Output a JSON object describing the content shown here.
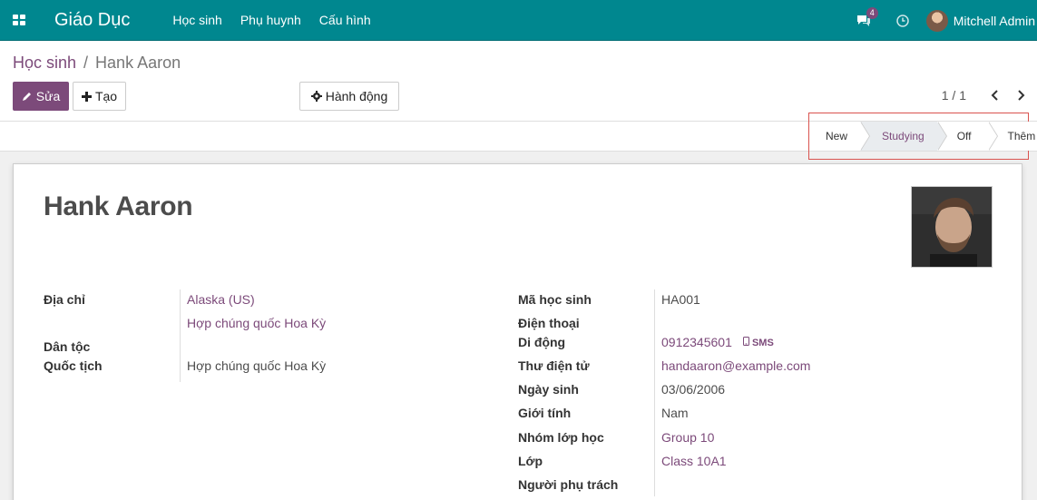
{
  "navbar": {
    "brand": "Giáo Dục",
    "menu": [
      "Học sinh",
      "Phụ huynh",
      "Cấu hình"
    ],
    "chat_count": "4",
    "user_name": "Mitchell Admin"
  },
  "breadcrumb": {
    "parent": "Học sinh",
    "separator": "/",
    "current": "Hank Aaron"
  },
  "toolbar": {
    "edit_label": "Sửa",
    "create_label": "Tạo",
    "action_label": "Hành động",
    "pager": "1 / 1"
  },
  "statusbar": {
    "stages": [
      "New",
      "Studying",
      "Off"
    ],
    "active_stage": "Studying",
    "more_label": "Thêm"
  },
  "record": {
    "name": "Hank Aaron",
    "left_fields": {
      "address_label": "Địa chỉ",
      "address_state": "Alaska (US)",
      "address_country": "Hợp chúng quốc Hoa Kỳ",
      "ethnicity_label": "Dân tộc",
      "ethnicity_value": "",
      "nationality_label": "Quốc tịch",
      "nationality_value": "Hợp chúng quốc Hoa Kỳ"
    },
    "right_fields": {
      "student_code_label": "Mã học sinh",
      "student_code_value": "HA001",
      "phone_label": "Điện thoại",
      "phone_value": "",
      "mobile_label": "Di động",
      "mobile_value": "0912345601",
      "sms_label": "SMS",
      "email_label": "Thư điện tử",
      "email_value": "handaaron@example.com",
      "birthday_label": "Ngày sinh",
      "birthday_value": "03/06/2006",
      "gender_label": "Giới tính",
      "gender_value": "Nam",
      "class_group_label": "Nhóm lớp học",
      "class_group_value": "Group 10",
      "class_label": "Lớp",
      "class_value": "Class 10A1",
      "responsible_label": "Người phụ trách",
      "responsible_value": ""
    }
  },
  "colors": {
    "navbar": "#00878f",
    "primary": "#7c4a7a",
    "highlight": "#d9534f"
  }
}
